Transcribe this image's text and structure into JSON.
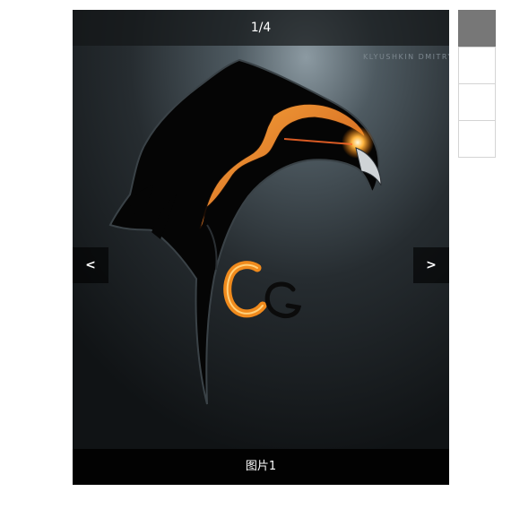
{
  "slider": {
    "counter": "1/4",
    "caption": "图片1",
    "prev_label": "<",
    "next_label": ">",
    "watermark": "KLYUSHKIN DMITRY"
  },
  "thumbnails": {
    "count": 4,
    "active_index": 0
  },
  "colors": {
    "active_thumb": "#777777",
    "thumb_border": "#d4d4d4",
    "flame_orange": "#f08a1c"
  }
}
